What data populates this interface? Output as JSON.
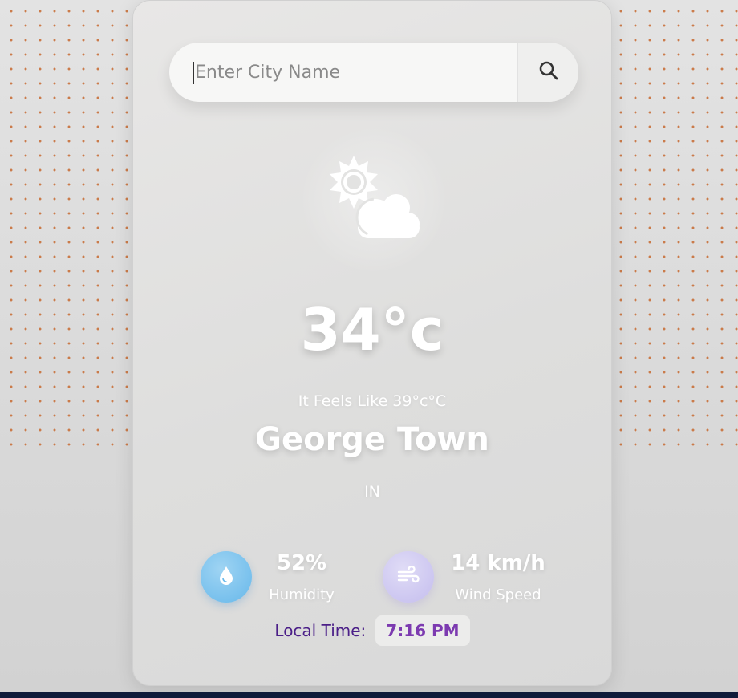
{
  "search": {
    "placeholder": "Enter City Name",
    "button_icon": "search-icon"
  },
  "weather": {
    "icon": "partly-cloudy-icon",
    "temperature": "34°c",
    "feels_like": "It Feels Like 39°c°C",
    "city": "George Town",
    "country": "IN"
  },
  "stats": {
    "humidity": {
      "icon": "water-drop-icon",
      "value": "52%",
      "label": "Humidity"
    },
    "wind": {
      "icon": "wind-icon",
      "value": "14 km/h",
      "label": "Wind Speed"
    }
  },
  "local_time": {
    "label": "Local Time:",
    "value": "7:16 PM"
  },
  "colors": {
    "accent_purple": "#7c3ab0",
    "label_purple": "#4b1f88",
    "humidity_blue": "#67b8ea",
    "wind_lavender": "#c4bdee",
    "dot_pattern": "#c8703a"
  }
}
